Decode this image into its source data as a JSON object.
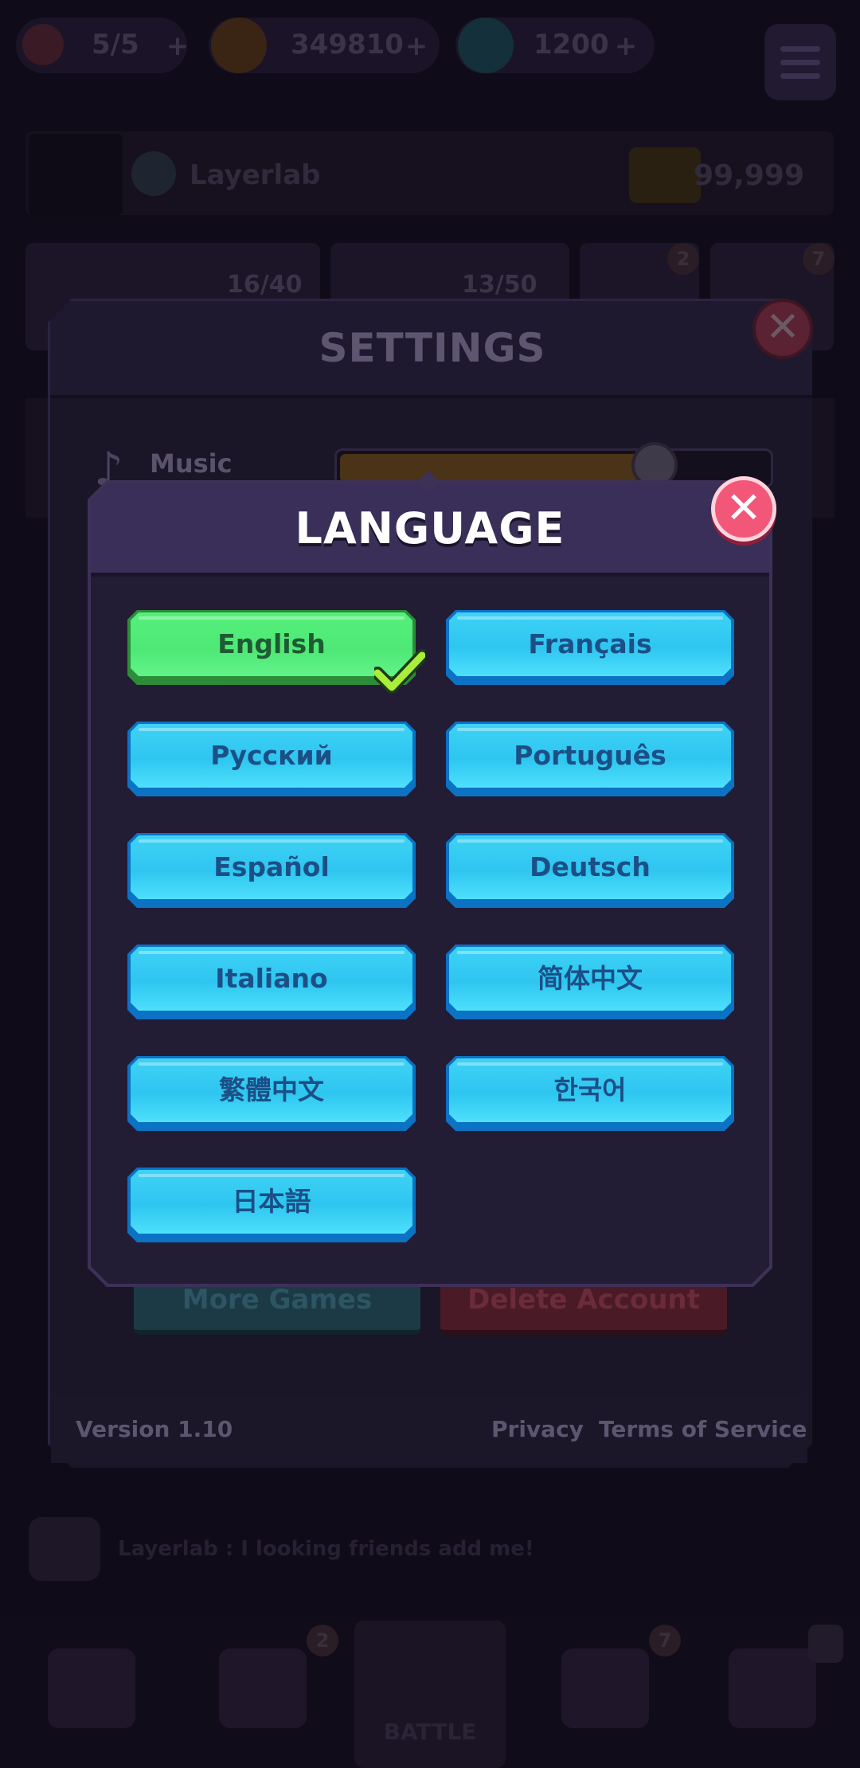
{
  "topbar": {
    "energy": "5/5",
    "coins": "349810",
    "gems": "1200"
  },
  "profile": {
    "name": "Layerlab",
    "trophies": "99,999"
  },
  "quests": {
    "progress_1": "16/40",
    "progress_2": "13/50",
    "badge_1": "2",
    "badge_2": "7"
  },
  "settings": {
    "title": "SETTINGS",
    "music_label": "Music",
    "music_level": 0.81,
    "more_games_label": "More Games",
    "delete_account_label": "Delete Account",
    "version": "Version 1.10",
    "privacy": "Privacy",
    "terms": "Terms of Service"
  },
  "chat": {
    "message": "Layerlab : I looking friends add me!"
  },
  "nav": {
    "battle_label": "BATTLE",
    "badge_left": "2",
    "badge_right": "7"
  },
  "language": {
    "title": "LANGUAGE",
    "selected": "English",
    "options": [
      "English",
      "Français",
      "Русский",
      "Português",
      "Español",
      "Deutsch",
      "Italiano",
      "简体中文",
      "繁體中文",
      "한국어",
      "日本語"
    ]
  },
  "colors": {
    "selected_button": "#4fe877",
    "button": "#2ec5f0",
    "close_button": "#f2577a"
  }
}
